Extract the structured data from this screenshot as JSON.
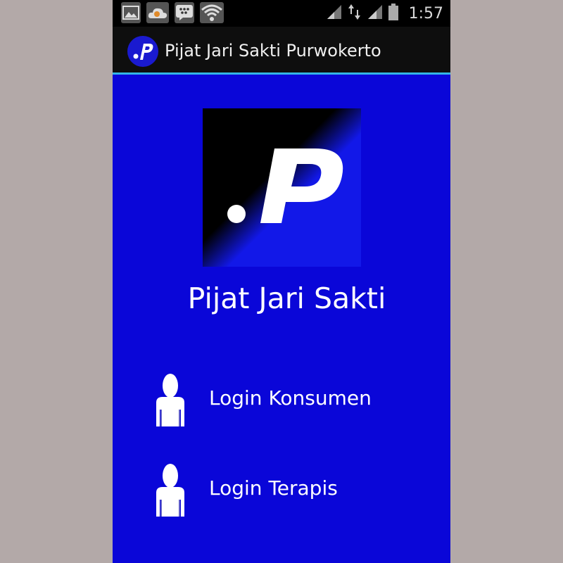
{
  "status_bar": {
    "icons_left": [
      "gallery-icon",
      "cloud-icon",
      "bbm-icon",
      "wifi-icon"
    ],
    "icons_right": [
      "signal-icon",
      "data-transfer-icon",
      "signal-icon",
      "battery-icon"
    ],
    "time": "1:57"
  },
  "action_bar": {
    "logo_text": ".P",
    "title": "Pijat Jari Sakti Purwokerto"
  },
  "main": {
    "logo_text": ".P",
    "app_name": "Pijat Jari Sakti",
    "menu": [
      {
        "label": "Login Konsumen",
        "icon": "person-icon"
      },
      {
        "label": "Login Terapis",
        "icon": "person-icon"
      }
    ]
  },
  "colors": {
    "background": "#0a06d8",
    "action_bar": "#0e0e0e",
    "accent_line": "#33b5e5",
    "text": "#ffffff"
  }
}
